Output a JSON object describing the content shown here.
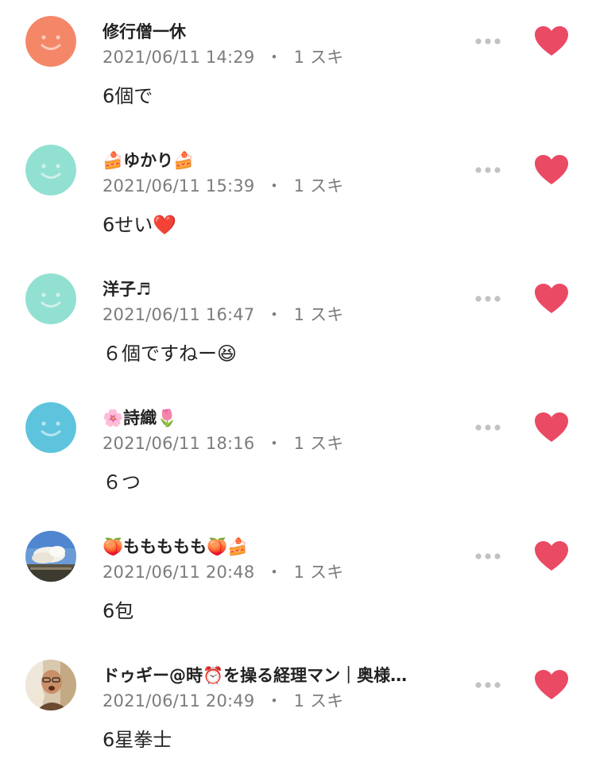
{
  "colors": {
    "heart": "#ea4a64",
    "meta_text": "#7c7c7c",
    "more_dots": "#c2c2c2"
  },
  "comments": [
    {
      "name": "修行僧一休",
      "timestamp": "2021/06/11 14:29",
      "separator": "・",
      "likes": "1 スキ",
      "text": "6個で",
      "avatar": {
        "type": "smiley",
        "color": "#f58769"
      }
    },
    {
      "name": "🍰ゆかり🍰",
      "timestamp": "2021/06/11 15:39",
      "separator": "・",
      "likes": "1 スキ",
      "text": "6せい❤️",
      "avatar": {
        "type": "smiley",
        "color": "#92e0d1"
      }
    },
    {
      "name": "洋子♬",
      "timestamp": "2021/06/11 16:47",
      "separator": "・",
      "likes": "1 スキ",
      "text": "６個ですねー😆",
      "avatar": {
        "type": "smiley",
        "color": "#92e0d1"
      }
    },
    {
      "name": "🌸詩織🌷",
      "timestamp": "2021/06/11 18:16",
      "separator": "・",
      "likes": "1 スキ",
      "text": "６つ",
      "avatar": {
        "type": "smiley",
        "color": "#5ec4dd"
      }
    },
    {
      "name": "🍑ももももも🍑🍰",
      "timestamp": "2021/06/11 20:48",
      "separator": "・",
      "likes": "1 スキ",
      "text": "6包",
      "avatar": {
        "type": "photo-sky"
      }
    },
    {
      "name": "ドゥギー@時⏰を操る経理マン｜奥様…",
      "timestamp": "2021/06/11 20:49",
      "separator": "・",
      "likes": "1 スキ",
      "text": "6星拳士",
      "avatar": {
        "type": "photo-person"
      }
    }
  ]
}
